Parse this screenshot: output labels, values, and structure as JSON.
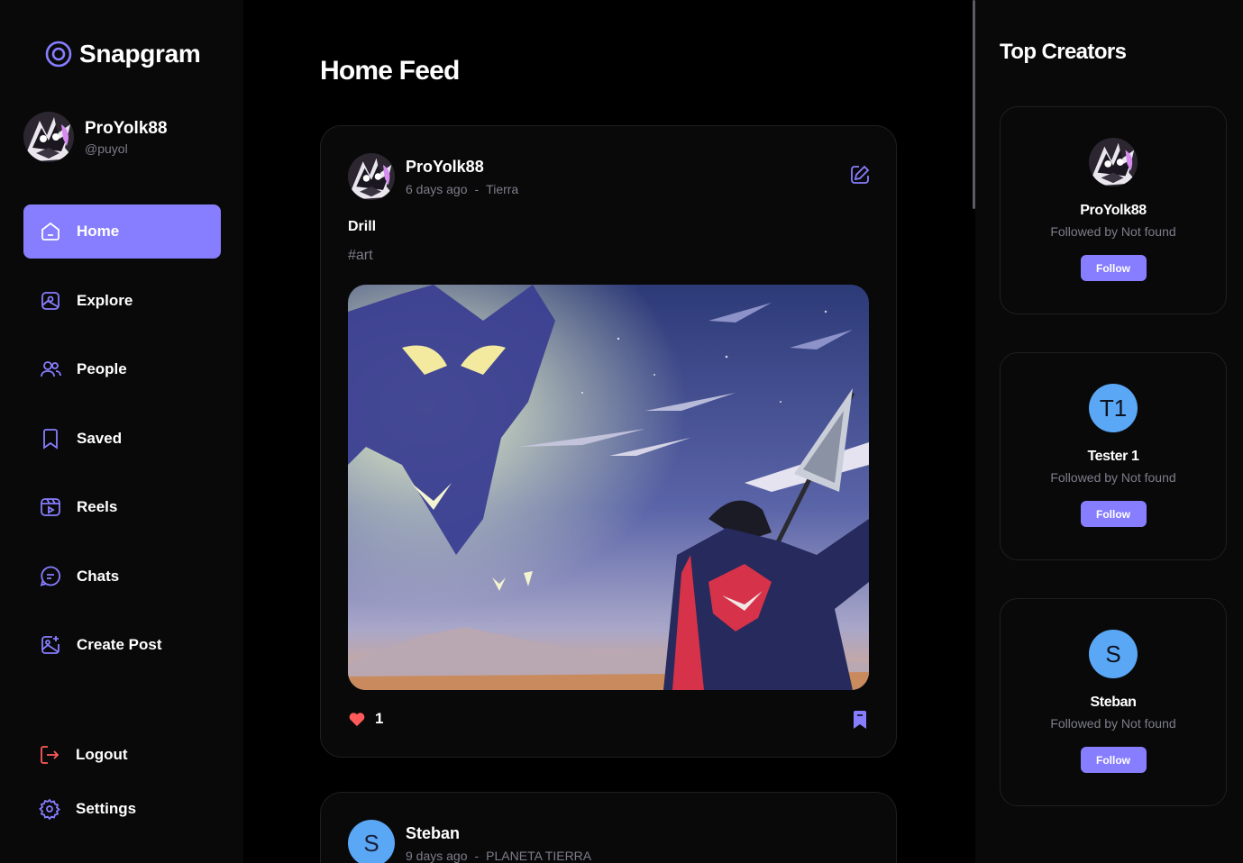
{
  "app": {
    "name": "Snapgram",
    "accent": "#877eff",
    "logo_icon": "camera-ring-icon"
  },
  "user": {
    "name": "ProYolk88",
    "handle": "@puyol"
  },
  "nav": {
    "items": [
      {
        "label": "Home",
        "icon": "home-icon",
        "active": true
      },
      {
        "label": "Explore",
        "icon": "gallery-icon"
      },
      {
        "label": "People",
        "icon": "people-icon"
      },
      {
        "label": "Saved",
        "icon": "bookmark-icon"
      },
      {
        "label": "Reels",
        "icon": "reels-icon"
      },
      {
        "label": "Chats",
        "icon": "chat-icon"
      },
      {
        "label": "Create Post",
        "icon": "add-image-icon"
      }
    ],
    "logout": "Logout",
    "settings": "Settings"
  },
  "feed": {
    "title": "Home Feed",
    "posts": [
      {
        "author": "ProYolk88",
        "time": "6 days ago",
        "separator": "-",
        "location": "Tierra",
        "caption": "Drill",
        "tags": "#art",
        "likes": "1",
        "image": "anime-artwork-warrior-with-drill-spear"
      },
      {
        "author": "Steban",
        "avatar_letter": "S",
        "time": "9 days ago",
        "separator": "-",
        "location": "PLANETA TIERRA"
      }
    ]
  },
  "top_creators": {
    "title": "Top Creators",
    "items": [
      {
        "name": "ProYolk88",
        "subtitle": "Followed by Not found",
        "button": "Follow",
        "avatar": "image"
      },
      {
        "name": "Tester 1",
        "subtitle": "Followed by Not found",
        "button": "Follow",
        "avatar_letter": "T1"
      },
      {
        "name": "Steban",
        "subtitle": "Followed by Not found",
        "button": "Follow",
        "avatar_letter": "S"
      }
    ]
  }
}
